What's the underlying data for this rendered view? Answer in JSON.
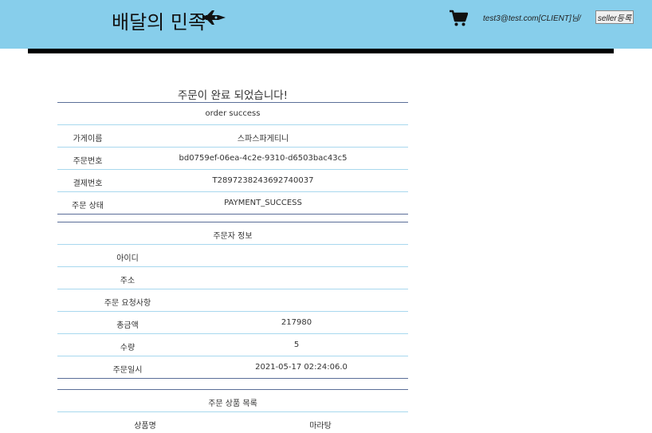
{
  "header": {
    "logo_text": "배달의 민족",
    "user_text": "test3@test.com[CLIENT]님/",
    "seller_button": "seller등록"
  },
  "order": {
    "title": "주문이 완료 되었습니다!",
    "subtitle": "order success",
    "rows": [
      {
        "label": "가게이름",
        "value": "스파스파게티니"
      },
      {
        "label": "주문번호",
        "value": "bd0759ef-06ea-4c2e-9310-d6503bac43c5"
      },
      {
        "label": "결제번호",
        "value": "T2897238243692740037"
      },
      {
        "label": "주문 상태",
        "value": "PAYMENT_SUCCESS"
      }
    ]
  },
  "orderer": {
    "heading": "주문자 정보",
    "rows": [
      {
        "label": "아이디",
        "value": ""
      },
      {
        "label": "주소",
        "value": ""
      },
      {
        "label": "주문 요청사항",
        "value": ""
      },
      {
        "label": "총금액",
        "value": "217980"
      },
      {
        "label": "수량",
        "value": "5"
      },
      {
        "label": "주문일시",
        "value": "2021-05-17 02:24:06.0"
      }
    ]
  },
  "products": {
    "heading": "주문 상품 목록",
    "rows": [
      {
        "label": "상품명",
        "value": "마라탕"
      }
    ]
  }
}
